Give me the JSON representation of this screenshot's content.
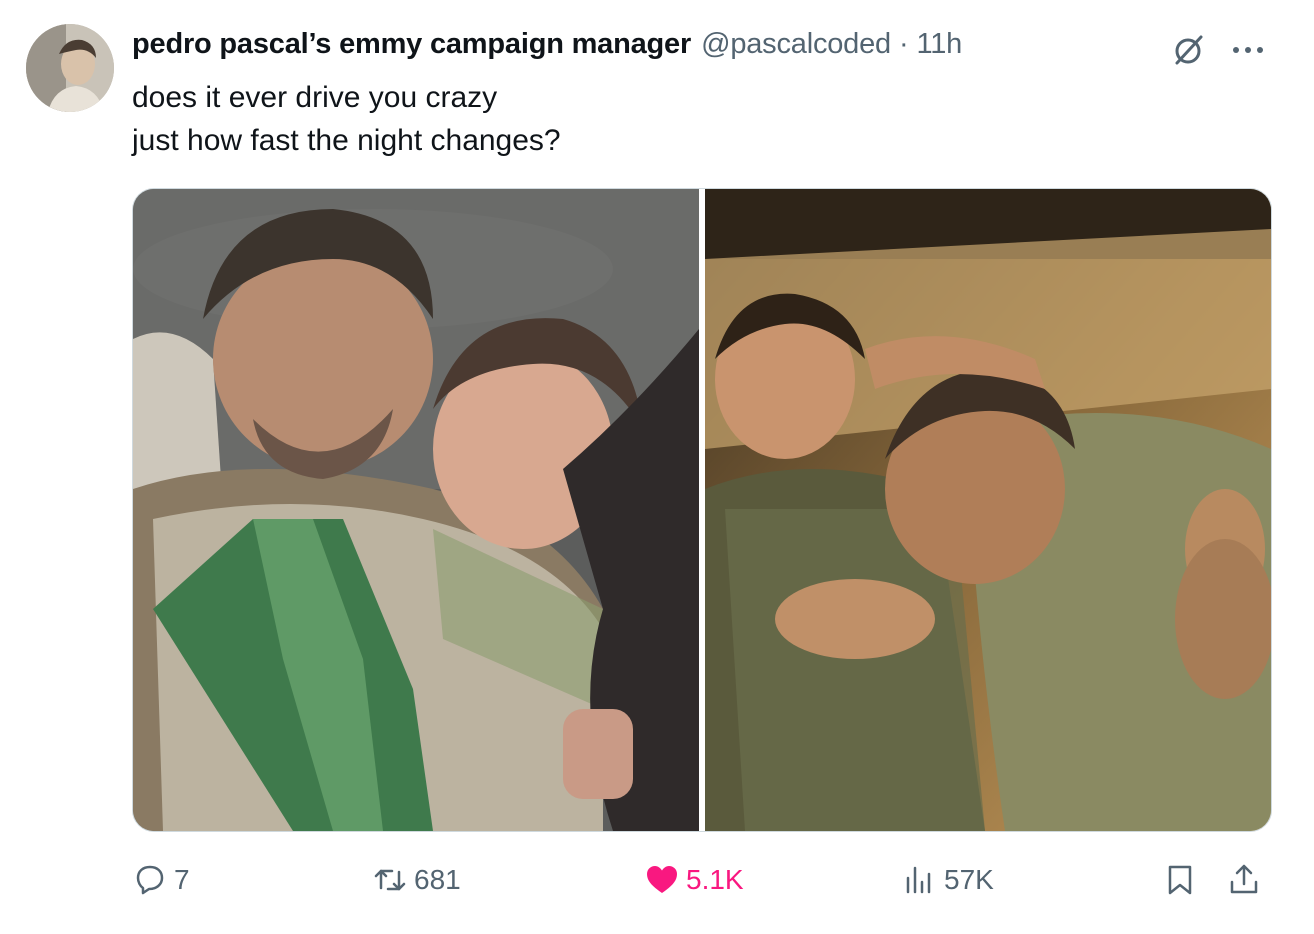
{
  "tweet": {
    "author_name": "pedro pascal’s emmy campaign manager",
    "handle": "@pascalcoded",
    "separator": "·",
    "time": "11h",
    "text_lines": [
      "does it ever drive you crazy",
      "just how fast the night changes?"
    ]
  },
  "media": {
    "images": [
      {
        "icon": "photo-icon"
      },
      {
        "icon": "photo-icon"
      }
    ]
  },
  "actions": {
    "replies": "7",
    "retweets": "681",
    "likes": "5.1K",
    "views": "57K"
  },
  "icons": {
    "grok": "grok-icon",
    "more": "more-icon",
    "reply": "reply-icon",
    "retweet": "retweet-icon",
    "like": "heart-icon",
    "views": "views-icon",
    "bookmark": "bookmark-icon",
    "share": "share-icon"
  },
  "colors": {
    "text": "#0f1419",
    "secondary": "#536471",
    "like": "#f91880",
    "border": "#cfd9de"
  }
}
